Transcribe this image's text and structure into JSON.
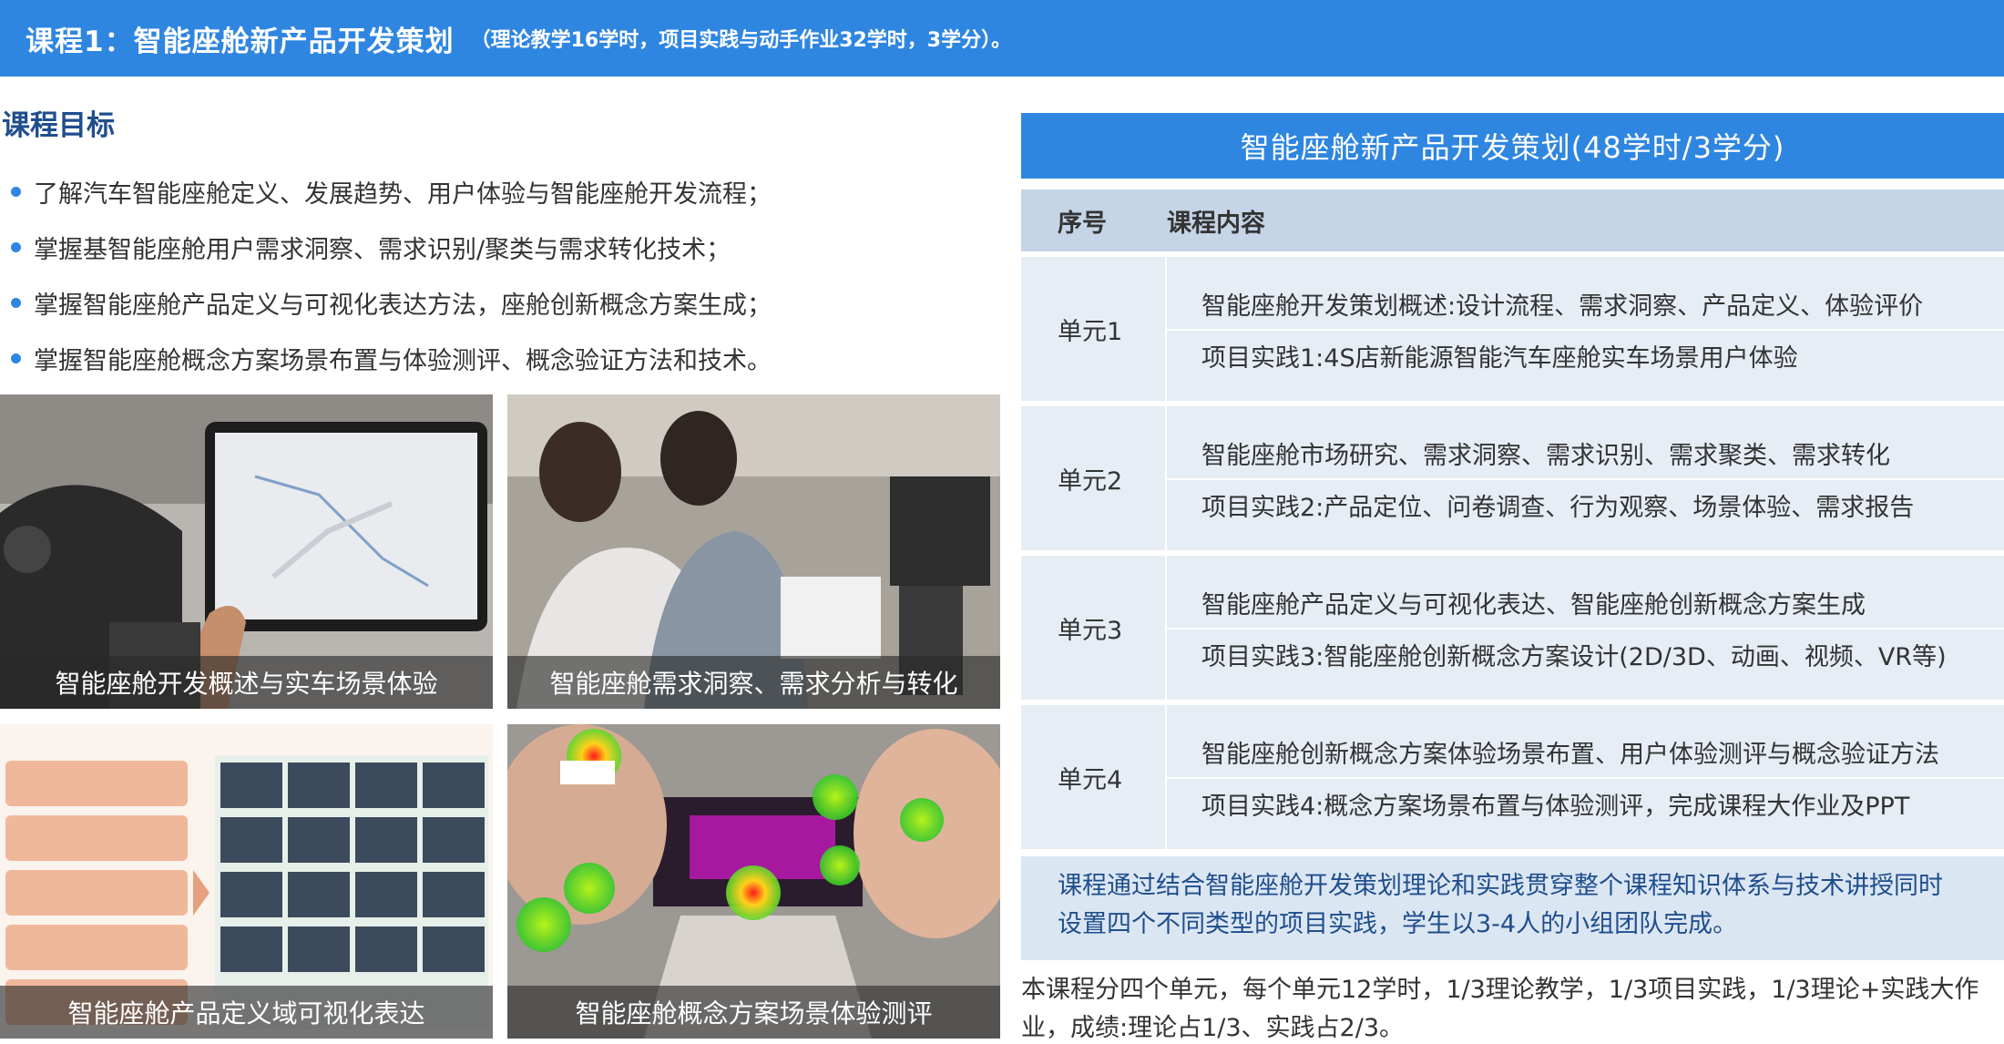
{
  "header": {
    "title": "课程1：智能座舱新产品开发策划",
    "subtitle": "（理论教学16学时，项目实践与动手作业32学时，3学分）。"
  },
  "goals": {
    "title": "课程目标",
    "items": [
      "了解汽车智能座舱定义、发展趋势、用户体验与智能座舱开发流程；",
      "掌握基智能座舱用户需求洞察、需求识别/聚类与需求转化技术；",
      "掌握智能座舱产品定义与可视化表达方法，座舱创新概念方案生成；",
      "掌握智能座舱概念方案场景布置与体验测评、概念验证方法和技术。"
    ]
  },
  "photos": [
    {
      "caption": "智能座舱开发概述与实车场景体验"
    },
    {
      "caption": "智能座舱需求洞察、需求分析与转化"
    },
    {
      "caption": "智能座舱产品定义域可视化表达"
    },
    {
      "caption": "智能座舱概念方案场景体验测评"
    }
  ],
  "table": {
    "title": "智能座舱新产品开发策划(48学时/3学分)",
    "col_seq": "序号",
    "col_content": "课程内容",
    "units": [
      {
        "label": "单元1",
        "items": [
          "智能座舱开发策划概述:设计流程、需求洞察、产品定义、体验评价",
          "项目实践1:4S店新能源智能汽车座舱实车场景用户体验"
        ]
      },
      {
        "label": "单元2",
        "items": [
          "智能座舱市场研究、需求洞察、需求识别、需求聚类、需求转化",
          "项目实践2:产品定位、问卷调查、行为观察、场景体验、需求报告"
        ]
      },
      {
        "label": "单元3",
        "items": [
          "智能座舱产品定义与可视化表达、智能座舱创新概念方案生成",
          "项目实践3:智能座舱创新概念方案设计(2D/3D、动画、视频、VR等)"
        ]
      },
      {
        "label": "单元4",
        "items": [
          "智能座舱创新概念方案体验场景布置、用户体验测评与概念验证方法",
          "项目实践4:概念方案场景布置与体验测评，完成课程大作业及PPT"
        ]
      }
    ],
    "note": [
      "课程通过结合智能座舱开发策划理论和实践贯穿整个课程知识体系与技术讲授同时",
      "设置四个不同类型的项目实践，学生以3-4人的小组团队完成。"
    ]
  },
  "footer": [
    "本课程分四个单元，每个单元12学时，1/3理论教学，1/3项目实践，1/3理论+实践大作",
    "业，成绩:理论占1/3、实践占2/3。"
  ],
  "colors": {
    "accent": "#2f86e0",
    "heading": "#1f4e8c",
    "row_bg": "#e6edf5",
    "col_head_bg": "#c5d4e6"
  }
}
